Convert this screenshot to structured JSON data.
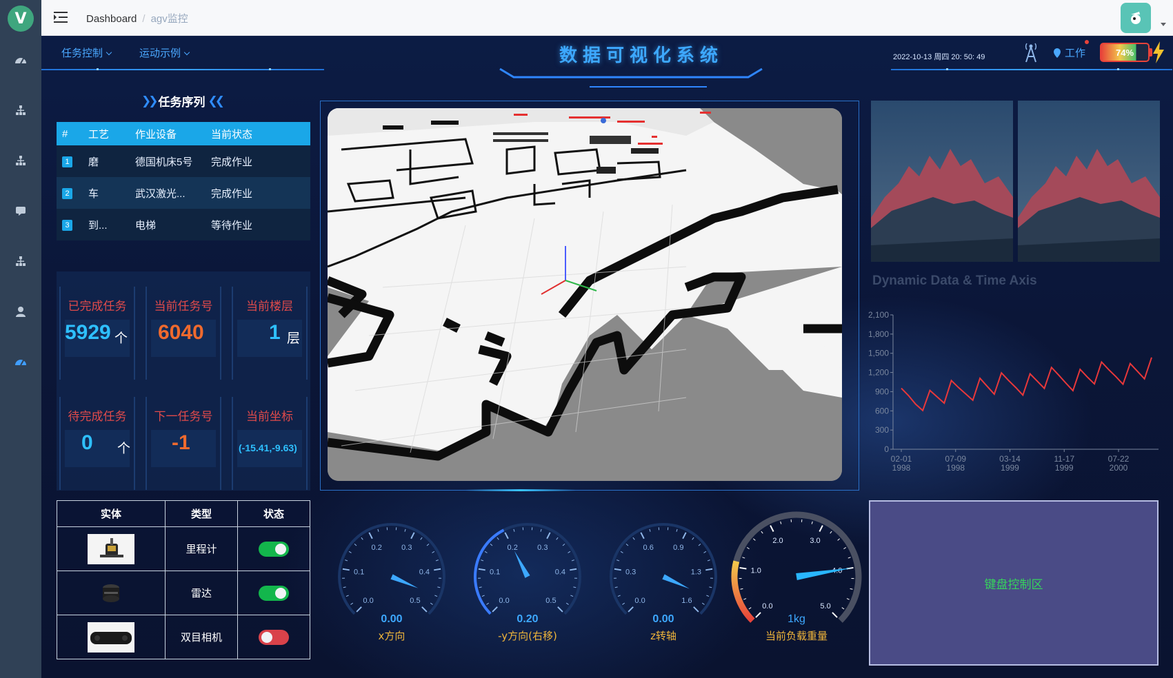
{
  "topbar": {
    "breadcrumb_home": "Dashboard",
    "breadcrumb_sep": "/",
    "breadcrumb_current": "agv监控"
  },
  "header": {
    "menu_task": "任务控制",
    "menu_motion": "运动示例",
    "title": "数据可视化系统",
    "datetime": "2022-10-13 周四 20: 50: 49",
    "status": "工作",
    "battery": "74%",
    "battery_level": 0.74
  },
  "tasks": {
    "title": "任务序列",
    "columns": [
      "#",
      "工艺",
      "作业设备",
      "当前状态"
    ],
    "rows": [
      {
        "index": "1",
        "process": "磨",
        "device": "德国机床5号",
        "status": "完成作业"
      },
      {
        "index": "2",
        "process": "车",
        "device": "武汉激光...",
        "status": "完成作业"
      },
      {
        "index": "3",
        "process": "到...",
        "device": "电梯",
        "status": "等待作业"
      }
    ]
  },
  "stats": {
    "completed_label": "已完成任务",
    "completed_value": "5929",
    "completed_unit": "个",
    "current_label": "当前任务号",
    "current_value": "6040",
    "floor_label": "当前楼层",
    "floor_value": "1",
    "floor_unit": "层",
    "pending_label": "待完成任务",
    "pending_value": "0",
    "pending_unit": "个",
    "next_label": "下一任务号",
    "next_value": "-1",
    "coord_label": "当前坐标",
    "coord_value": "(-15.41,-9.63)"
  },
  "entities": {
    "columns": [
      "实体",
      "类型",
      "状态"
    ],
    "rows": [
      {
        "type": "里程计",
        "enabled": true
      },
      {
        "type": "雷达",
        "enabled": true
      },
      {
        "type": "双目相机",
        "enabled": false
      }
    ]
  },
  "gauges": [
    {
      "label": "x方向",
      "value": "0.00",
      "ticks": [
        "0.0",
        "0.1",
        "0.2",
        "0.3",
        "0.4",
        "0.5"
      ],
      "min": 0,
      "max": 0.5,
      "reading": 0.46
    },
    {
      "label": "-y方向(右移)",
      "value": "0.20",
      "ticks": [
        "0.0",
        "0.1",
        "0.2",
        "0.3",
        "0.4",
        "0.5"
      ],
      "min": 0,
      "max": 0.5,
      "reading": 0.2
    },
    {
      "label": "z转轴",
      "value": "0.00",
      "ticks": [
        "0.0",
        "0.3",
        "0.6",
        "0.9",
        "1.3",
        "1.6"
      ],
      "min": 0,
      "max": 1.6,
      "reading": 1.48
    },
    {
      "label": "当前负载重量",
      "value": "1kg",
      "ticks": [
        "0.0",
        "1.0",
        "2.0",
        "3.0",
        "4.0",
        "5.0"
      ],
      "min": 0,
      "max": 5,
      "reading": 4.0
    }
  ],
  "chart_data": {
    "type": "line",
    "title": "Dynamic Data & Time Axis",
    "x_ticks": [
      "02-01\n1998",
      "07-09\n1998",
      "03-14\n1999",
      "11-17\n1999",
      "07-22\n2000"
    ],
    "x_range": [
      "1998-02-01",
      "2000-08-30"
    ],
    "ylim": [
      0,
      2100
    ],
    "y_ticks": [
      "0",
      "300",
      "600",
      "900",
      "1,200",
      "1,500",
      "1,800",
      "2,100"
    ],
    "series": [
      {
        "values": [
          760,
          775,
          770,
          800,
          790,
          820,
          850,
          880,
          900,
          930,
          960,
          980,
          985,
          990,
          1000,
          1010,
          1030,
          1040,
          1050,
          1065,
          1080,
          1085,
          1095,
          1100,
          1110,
          1120,
          1130,
          1150,
          1170,
          1180,
          1200,
          1210,
          1210,
          1220,
          1230,
          1240
        ]
      }
    ],
    "color": "#e8383a"
  },
  "keyboard": {
    "label": "键盘控制区"
  },
  "colors": {
    "accent": "#3da8ff",
    "table_header": "#1aa7e8",
    "orange": "#ef6a2e",
    "danger": "#e8433a",
    "ok": "#13b64c"
  }
}
